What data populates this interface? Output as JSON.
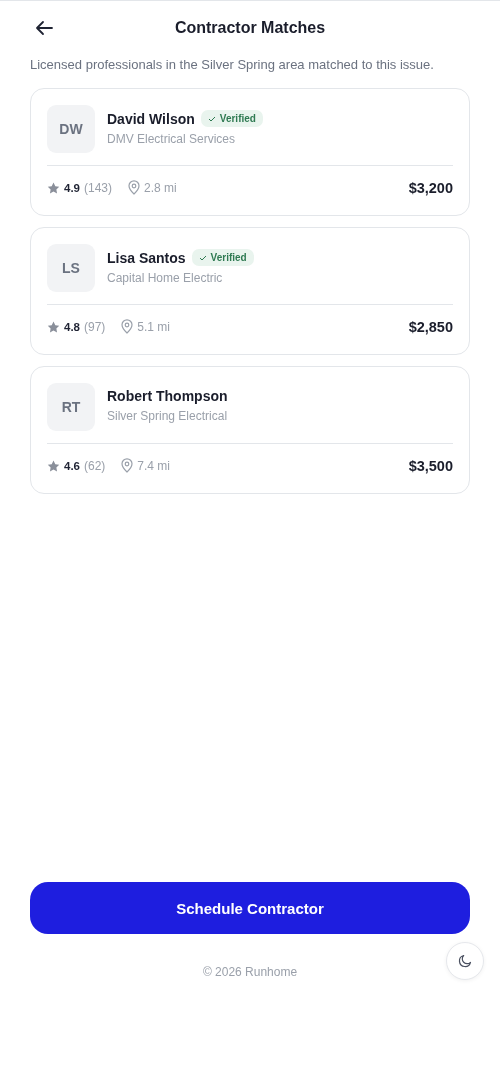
{
  "header": {
    "title": "Contractor Matches"
  },
  "intro": "Licensed professionals in the Silver Spring area matched to this issue.",
  "contractors": [
    {
      "initials": "DW",
      "name": "David Wilson",
      "verified": true,
      "badge": "Verified",
      "company": "DMV Electrical Services",
      "rating": "4.9",
      "reviews": "(143)",
      "distance": "2.8 mi",
      "price": "$3,200"
    },
    {
      "initials": "LS",
      "name": "Lisa Santos",
      "verified": true,
      "badge": "Verified",
      "company": "Capital Home Electric",
      "rating": "4.8",
      "reviews": "(97)",
      "distance": "5.1 mi",
      "price": "$2,850"
    },
    {
      "initials": "RT",
      "name": "Robert Thompson",
      "verified": false,
      "company": "Silver Spring Electrical",
      "rating": "4.6",
      "reviews": "(62)",
      "distance": "7.4 mi",
      "price": "$3,500"
    }
  ],
  "primary_button": "Schedule Contractor",
  "footer": "© 2026 Runhome"
}
